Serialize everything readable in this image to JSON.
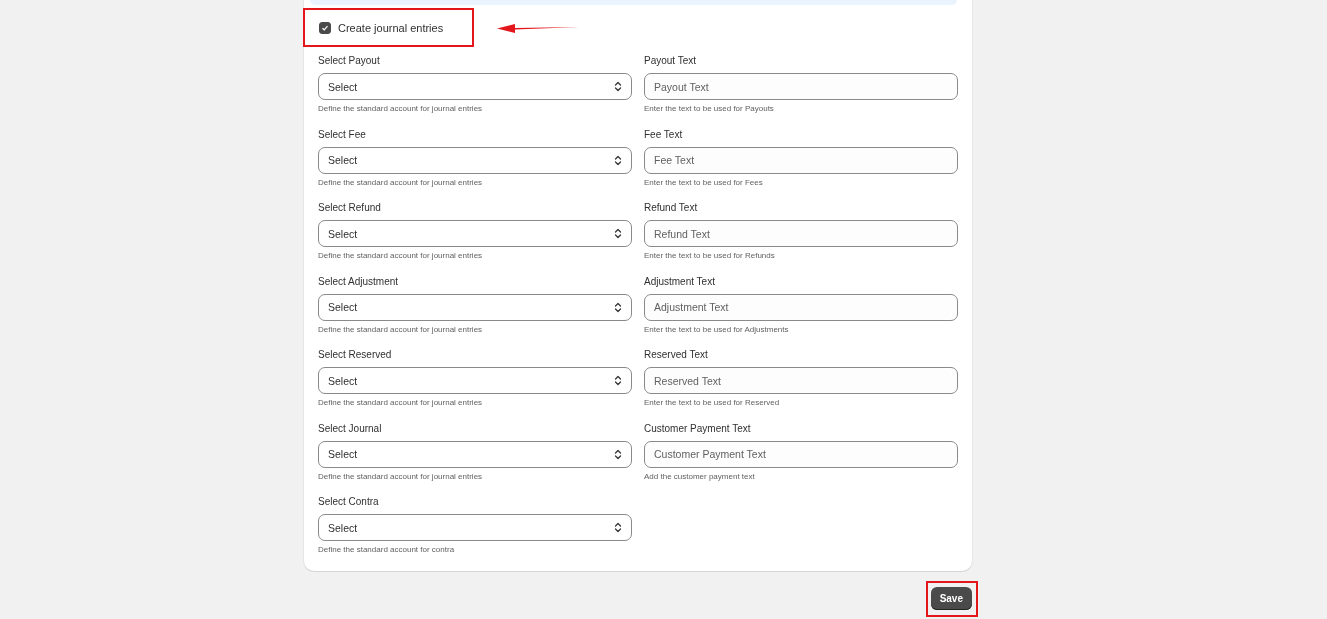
{
  "journal_toggle": {
    "label": "Create journal entries",
    "checked": true
  },
  "account_selects": [
    {
      "label": "Select Payout",
      "value": "Select",
      "help": "Define the standard account for journal entries"
    },
    {
      "label": "Select Fee",
      "value": "Select",
      "help": "Define the standard account for journal entries"
    },
    {
      "label": "Select Refund",
      "value": "Select",
      "help": "Define the standard account for journal entries"
    },
    {
      "label": "Select Adjustment",
      "value": "Select",
      "help": "Define the standard account for journal entries"
    },
    {
      "label": "Select Reserved",
      "value": "Select",
      "help": "Define the standard account for journal entries"
    },
    {
      "label": "Select Journal",
      "value": "Select",
      "help": "Define the standard account for journal entries"
    },
    {
      "label": "Select Contra",
      "value": "Select",
      "help": "Define the standard account for contra"
    }
  ],
  "text_fields": [
    {
      "label": "Payout Text",
      "placeholder": "Payout Text",
      "help": "Enter the text to be used for Payouts"
    },
    {
      "label": "Fee Text",
      "placeholder": "Fee Text",
      "help": "Enter the text to be used for Fees"
    },
    {
      "label": "Refund Text",
      "placeholder": "Refund Text",
      "help": "Enter the text to be used for Refunds"
    },
    {
      "label": "Adjustment Text",
      "placeholder": "Adjustment Text",
      "help": "Enter the text to be used for Adjustments"
    },
    {
      "label": "Reserved Text",
      "placeholder": "Reserved Text",
      "help": "Enter the text to be used for Reserved"
    },
    {
      "label": "Customer Payment Text",
      "placeholder": "Customer Payment Text",
      "help": "Add the customer payment text"
    }
  ],
  "save_button": "Save"
}
